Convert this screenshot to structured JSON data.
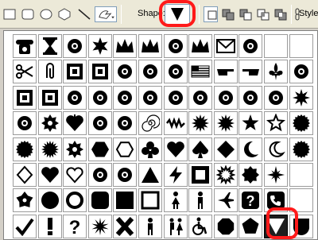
{
  "toolbar": {
    "shape_label": "Shape:",
    "style_label": "Style",
    "selected_shape": "triangle-down",
    "tools": [
      "rectangle-tool",
      "rounded-rectangle-tool",
      "ellipse-tool",
      "polygon-tool",
      "line-tool",
      "custom-shape-tool"
    ],
    "combine_modes": [
      "new-layer-mode",
      "add-mode",
      "subtract-mode",
      "intersect-mode",
      "exclude-mode"
    ]
  },
  "shape_grid": {
    "columns": 12,
    "rows": 8,
    "selected_index": 94,
    "shapes": [
      "telephone",
      "hourglass",
      "pushpin",
      "star-6",
      "crown-small",
      "crown-medium",
      "fleur-floral",
      "crown-large",
      "envelope",
      "bookmark",
      "blank",
      "blank",
      "scissors",
      "paperclip",
      "stamp",
      "tile-diamond",
      "dots-sparkle",
      "bird-flight",
      "holly",
      "flag-usa",
      "hand-point-right",
      "hand-point-left",
      "fleur-de-lis",
      "ornament",
      "frame-ornate",
      "frame-square",
      "diamond-cluster",
      "scroll-ornament",
      "medallion",
      "leaf-swirl",
      "butterfly-leaf",
      "flower-4",
      "curl",
      "flower-plant",
      "leaf-branch",
      "flower-star",
      "sprig",
      "flower-6",
      "heart-leaf",
      "splash",
      "swirl-leaf",
      "spiral",
      "zigzag",
      "burst",
      "starburst",
      "star",
      "star-outline",
      "seal",
      "seal-small",
      "burst-circle",
      "flower-round",
      "hexagon",
      "hexagon-outline",
      "club",
      "heart",
      "spade",
      "diamond",
      "crescent",
      "crescent-outline",
      "badge",
      "diamond-outline",
      "heart-filled",
      "heart-outline",
      "star-badge",
      "circle-star",
      "triangle-up",
      "lightning",
      "square-frame",
      "starburst-outline",
      "sun-blob",
      "cross-star",
      "blank",
      "flower-5",
      "circle",
      "ring",
      "square-rounded",
      "square",
      "square-outline",
      "woman",
      "man",
      "airplane",
      "question-box",
      "phone-box",
      "blank",
      "check",
      "exclamation",
      "question",
      "starburst-small",
      "x-mark",
      "pedestrian",
      "couple",
      "wheelchair",
      "octagon",
      "pentagon",
      "triangle-down",
      "shield"
    ]
  }
}
